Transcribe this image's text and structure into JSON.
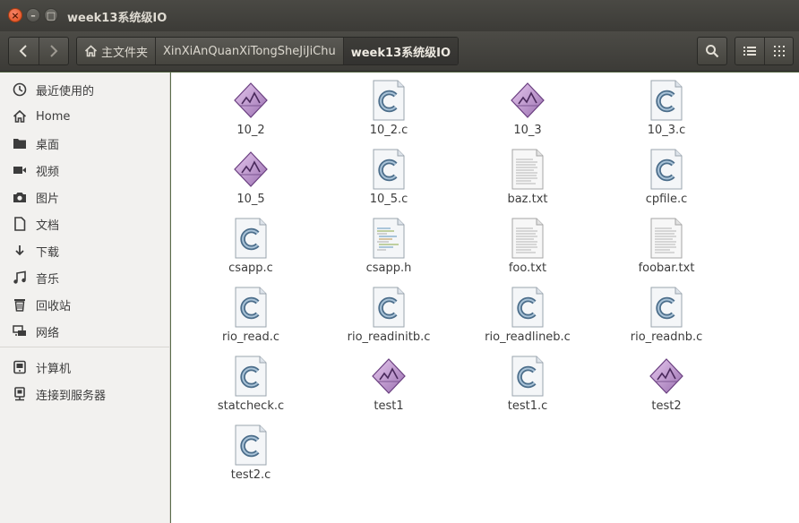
{
  "window": {
    "title": "week13系统级IO"
  },
  "toolbar": {
    "breadcrumbs": [
      "主文件夹",
      "XinXiAnQuanXiTongSheJiJiChu",
      "week13系统级IO"
    ]
  },
  "sidebar": {
    "items": [
      "最近使用的",
      "Home",
      "桌面",
      "视频",
      "图片",
      "文档",
      "下载",
      "音乐",
      "回收站",
      "网络",
      "计算机",
      "连接到服务器"
    ]
  },
  "files": [
    {
      "name": "10_2",
      "type": "executable"
    },
    {
      "name": "10_2.c",
      "type": "c-source"
    },
    {
      "name": "10_3",
      "type": "executable"
    },
    {
      "name": "10_3.c",
      "type": "c-source"
    },
    {
      "name": "10_5",
      "type": "executable"
    },
    {
      "name": "10_5.c",
      "type": "c-source"
    },
    {
      "name": "baz.txt",
      "type": "text"
    },
    {
      "name": "cpfile.c",
      "type": "c-source"
    },
    {
      "name": "csapp.c",
      "type": "c-source"
    },
    {
      "name": "csapp.h",
      "type": "c-header"
    },
    {
      "name": "foo.txt",
      "type": "text"
    },
    {
      "name": "foobar.txt",
      "type": "text"
    },
    {
      "name": "rio_read.c",
      "type": "c-source"
    },
    {
      "name": "rio_readinitb.c",
      "type": "c-source"
    },
    {
      "name": "rio_readlineb.c",
      "type": "c-source"
    },
    {
      "name": "rio_readnb.c",
      "type": "c-source"
    },
    {
      "name": "statcheck.c",
      "type": "c-source"
    },
    {
      "name": "test1",
      "type": "executable"
    },
    {
      "name": "test1.c",
      "type": "c-source"
    },
    {
      "name": "test2",
      "type": "executable"
    },
    {
      "name": "test2.c",
      "type": "c-source"
    }
  ]
}
